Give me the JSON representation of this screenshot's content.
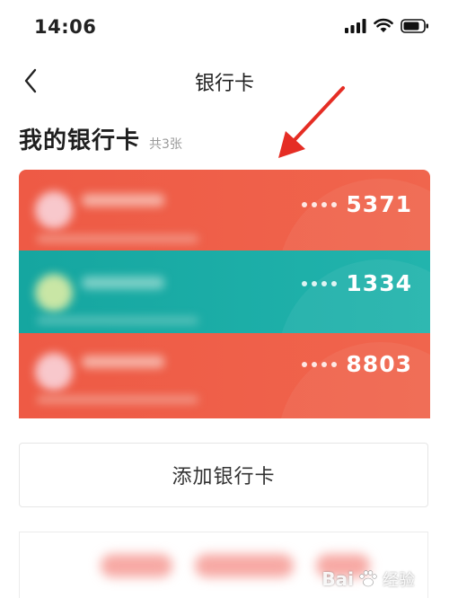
{
  "status_bar": {
    "time": "14:06"
  },
  "nav": {
    "title": "银行卡"
  },
  "section": {
    "title": "我的银行卡",
    "count": "共3张"
  },
  "cards": [
    {
      "masked": "••••",
      "last4": "5371",
      "color": "#ef5e48"
    },
    {
      "masked": "••••",
      "last4": "1334",
      "color": "#1aaca5"
    },
    {
      "masked": "••••",
      "last4": "8803",
      "color": "#ef5e48"
    }
  ],
  "add_card": {
    "label": "添加银行卡"
  },
  "watermark": {
    "brand": "Bai",
    "suffix": "经验"
  },
  "colors": {
    "card_red": "#ef5e48",
    "card_teal": "#1aaca5",
    "annotation_arrow": "#e52d24"
  },
  "icons": [
    "signal-icon",
    "wifi-icon",
    "battery-icon",
    "back-chevron-icon",
    "paw-icon"
  ]
}
